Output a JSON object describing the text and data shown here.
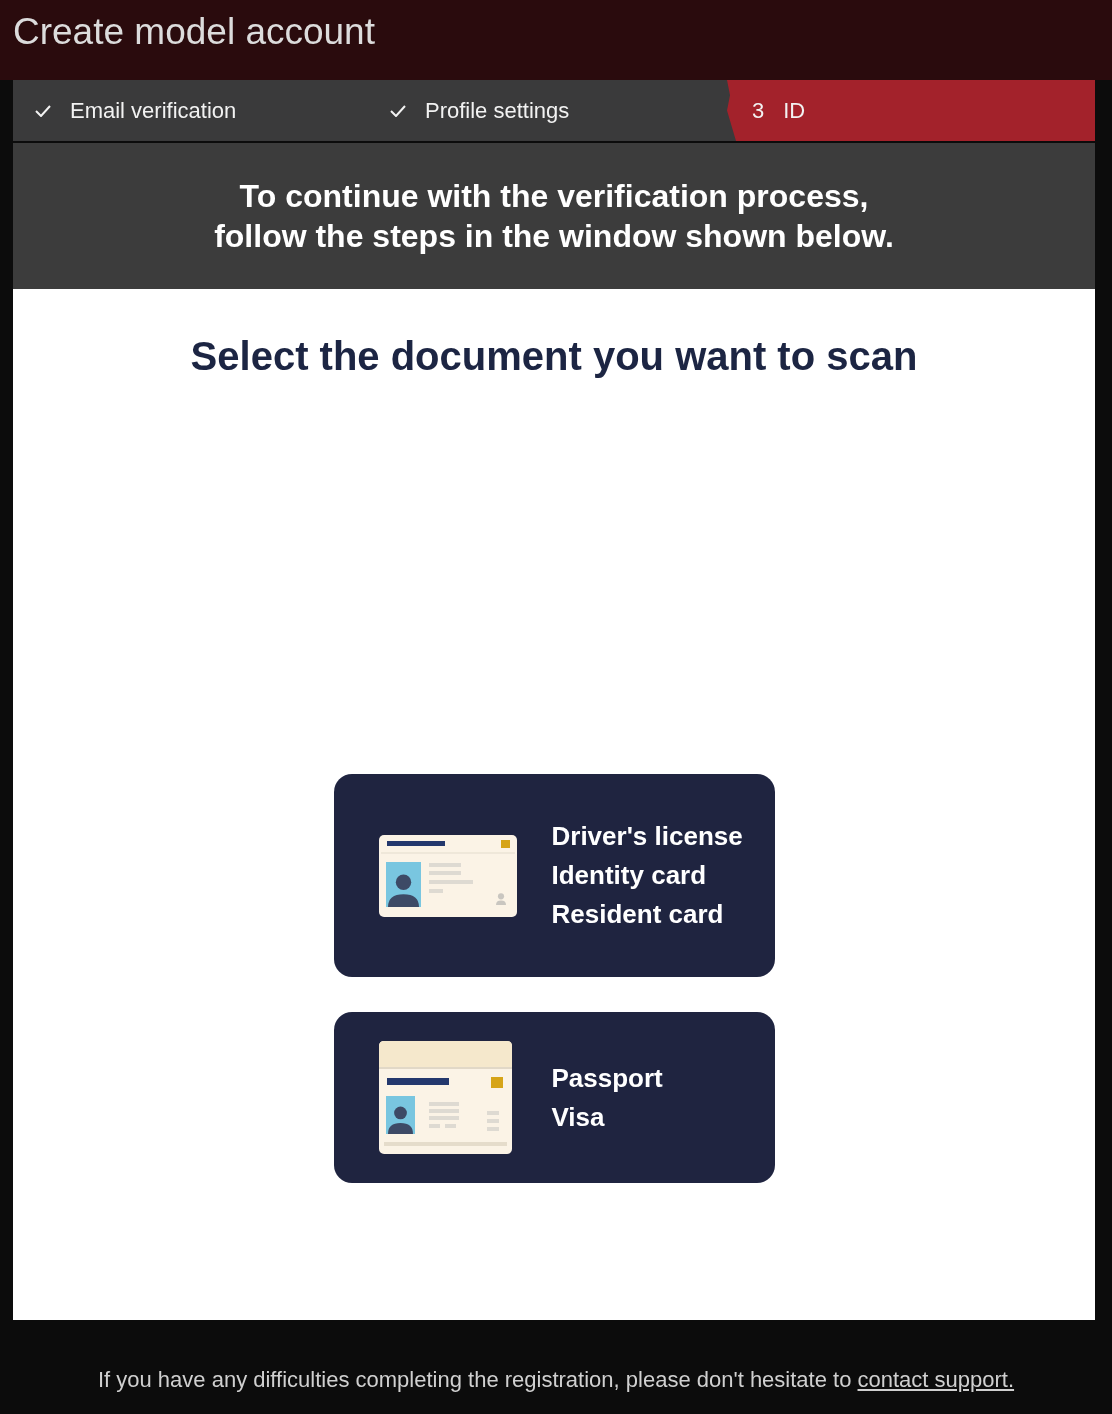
{
  "window": {
    "title": "Create model account"
  },
  "steps": [
    {
      "label": "Email verification",
      "completed": true,
      "selected": false
    },
    {
      "label": "Profile settings",
      "completed": true,
      "selected": false
    },
    {
      "number": "3",
      "label": "ID",
      "completed": false,
      "selected": true
    }
  ],
  "banner": {
    "lines": [
      "To continue with the verification process,",
      "follow the steps in the window shown below."
    ]
  },
  "document_picker": {
    "heading": "Select the document you want to scan",
    "options": [
      {
        "kind": "id-card",
        "labels": [
          "Driver's license",
          "Identity card",
          "Resident card"
        ]
      },
      {
        "kind": "passport",
        "labels": [
          "Passport",
          "Visa"
        ]
      }
    ]
  },
  "footer": {
    "text": "If you have any difficulties completing the registration, please don't hesitate to",
    "link": "contact support."
  }
}
